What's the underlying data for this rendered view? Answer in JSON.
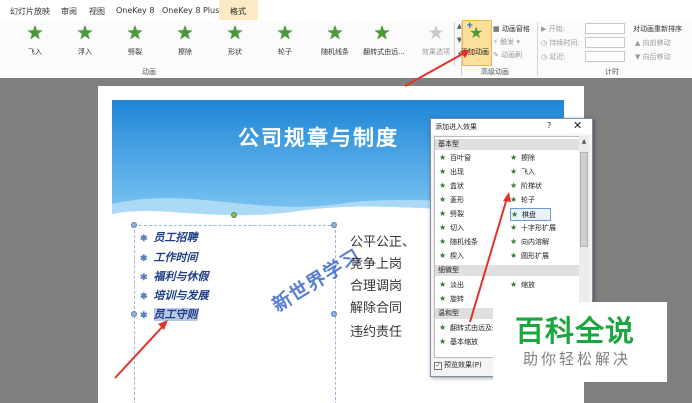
{
  "tabs": [
    {
      "label": "幻灯片放映"
    },
    {
      "label": "审阅"
    },
    {
      "label": "视图"
    },
    {
      "label": "OneKey 8"
    },
    {
      "label": "OneKey 8 Plus"
    },
    {
      "label": "格式",
      "active": true
    }
  ],
  "effects": [
    {
      "label": "飞入",
      "icon": "star-fly-in-icon"
    },
    {
      "label": "浮入",
      "icon": "star-float-in-icon"
    },
    {
      "label": "劈裂",
      "icon": "star-split-icon"
    },
    {
      "label": "擦除",
      "icon": "star-wipe-icon"
    },
    {
      "label": "形状",
      "icon": "star-shape-icon"
    },
    {
      "label": "轮子",
      "icon": "star-wheel-icon"
    },
    {
      "label": "随机线条",
      "icon": "star-random-bars-icon"
    },
    {
      "label": "翻转式由远...",
      "icon": "star-grow-turn-icon"
    },
    {
      "label": "效果选项",
      "icon": "star-effect-options-icon",
      "disabled": true
    }
  ],
  "ribbon": {
    "group_animation": "动画",
    "add_animation": "添加动画",
    "anim_pane": "动画窗格",
    "trigger": "触发",
    "anim_painter": "动画刷",
    "group_advanced": "高级动画",
    "start_label": "开始:",
    "duration_label": "持续时间:",
    "delay_label": "延迟:",
    "group_timing": "计时",
    "reorder_title": "对动画重新排序",
    "move_earlier": "向前移动",
    "move_later": "向后移动"
  },
  "slide": {
    "title": "公司规章与制度",
    "bullets": [
      "员工招聘",
      "工作时间",
      "福利与休假",
      "培训与发展",
      "员工守则"
    ],
    "right_lines": [
      "公平公正、",
      "竞争上岗",
      "合理调岗",
      "解除合同",
      "违约责任"
    ],
    "watermark": "新世界学习"
  },
  "dialog": {
    "title": "添加进入效果",
    "help": "?",
    "close": "✕",
    "cat_basic": "基本型",
    "basic_items": [
      [
        "百叶窗",
        "擦除"
      ],
      [
        "出现",
        "飞入"
      ],
      [
        "盒状",
        "阶梯状"
      ],
      [
        "菱形",
        "轮子"
      ],
      [
        "劈裂",
        "棋盘"
      ],
      [
        "切入",
        "十字形扩展"
      ],
      [
        "随机线条",
        "向内溶解"
      ],
      [
        "楔入",
        "圆形扩展"
      ]
    ],
    "cat_subtle": "细微型",
    "subtle_items": [
      [
        "淡出",
        "缩放"
      ],
      [
        "旋转",
        ""
      ]
    ],
    "cat_moderate": "温和型",
    "moderate_items": [
      "翻转式由远及近",
      "基本缩放"
    ],
    "preview": "预览效果(P)"
  },
  "logo": {
    "main": "百科全说",
    "sub": "助你轻松解决"
  }
}
